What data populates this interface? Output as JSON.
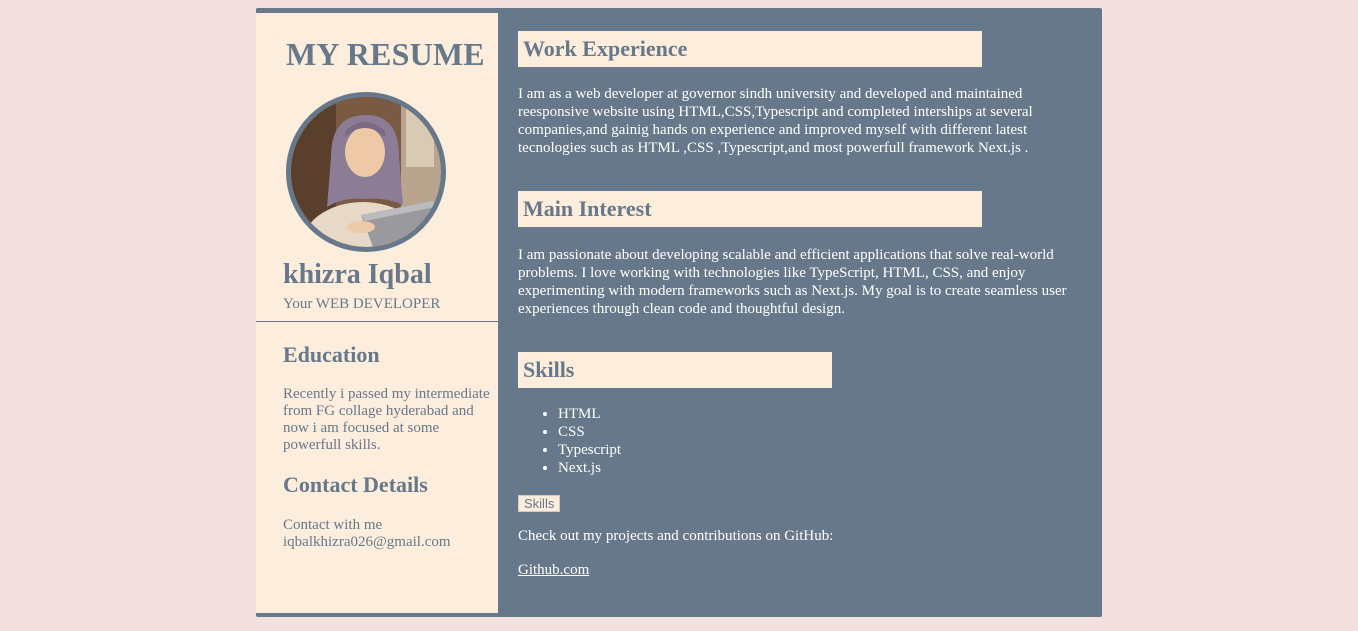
{
  "sidebar": {
    "title": "MY RESUME",
    "name": "khizra Iqbal",
    "role": "Your WEB DEVELOPER",
    "education": {
      "heading": "Education",
      "text": "Recently i passed my intermediate from FG collage hyderabad and now i am focused at some powerfull skills."
    },
    "contact": {
      "heading": "Contact Details",
      "line1": "Contact with me",
      "email": "iqbalkhizra026@gmail.com"
    }
  },
  "main": {
    "work": {
      "heading": "Work Experience",
      "text": "I am as a web developer at governor sindh university and developed and maintained reesponsive website using HTML,CSS,Typescript and completed interships at several companies,and gainig hands on experience and improved myself with different latest tecnologies such as HTML ,CSS ,Typescript,and most powerfull framework Next.js ."
    },
    "interest": {
      "heading": "Main Interest",
      "text": "I am passionate about developing scalable and efficient applications that solve real-world problems. I love working with technologies like TypeScript, HTML, CSS, and enjoy experimenting with modern frameworks such as Next.js. My goal is to create seamless user experiences through clean code and thoughtful design."
    },
    "skills": {
      "heading": "Skills",
      "items": [
        "HTML",
        "CSS",
        "Typescript",
        "Next.js"
      ],
      "button_label": "Skills"
    },
    "github": {
      "text": "Check out my projects and contributions on GitHub:",
      "link_label": "Github.com"
    }
  },
  "colors": {
    "page_background": "#f3e0e0",
    "slate": "#66788a",
    "cream": "#fdeddd"
  }
}
